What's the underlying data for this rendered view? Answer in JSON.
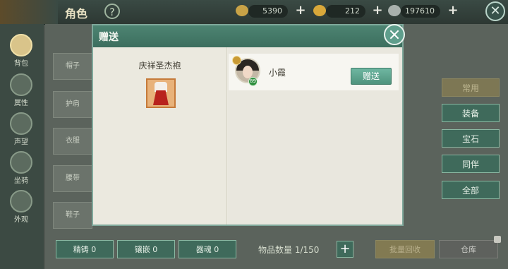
{
  "topbar": {
    "title": "角色",
    "help_icon": "?",
    "resources": [
      {
        "icon": "gold-coin-icon",
        "value": "5390"
      },
      {
        "icon": "gold-ingot-icon",
        "value": "212"
      },
      {
        "icon": "silver-icon",
        "value": "197610"
      }
    ]
  },
  "leftnav": {
    "items": [
      {
        "label": "背包"
      },
      {
        "label": "属性"
      },
      {
        "label": "声望"
      },
      {
        "label": "坐骑"
      },
      {
        "label": "外观"
      }
    ]
  },
  "inventory": {
    "row_labels": [
      "帽子",
      "护肩",
      "衣服",
      "腰带",
      "鞋子"
    ]
  },
  "side_buttons": [
    "常用",
    "装备",
    "宝石",
    "同伴",
    "全部"
  ],
  "bottom": {
    "refine": "精铸 0",
    "inlay": "镶嵌 0",
    "engrave": "器魂 0",
    "item_count": "物品数量 1/150",
    "batch_recycle": "批量回收",
    "warehouse": "仓库"
  },
  "modal": {
    "title": "赠送",
    "item_name": "庆祥圣杰袍",
    "friend": {
      "name": "小霞",
      "level": "89",
      "action": "赠送"
    }
  }
}
